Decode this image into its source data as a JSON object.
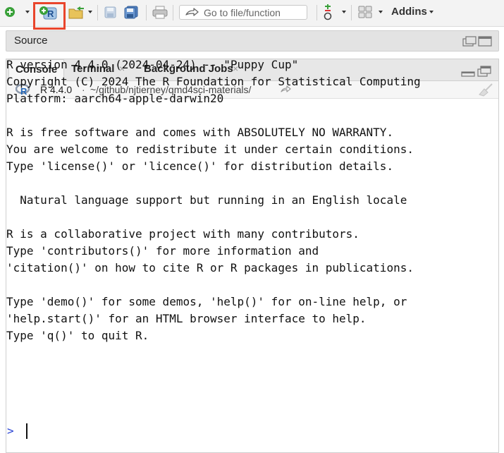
{
  "toolbar": {
    "goto_placeholder": "Go to file/function",
    "addins_label": "Addins"
  },
  "source_pane": {
    "title": "Source"
  },
  "console_pane": {
    "tabs": [
      {
        "label": "Console"
      },
      {
        "label": "Terminal",
        "close": "×"
      },
      {
        "label": "Background Jobs",
        "close": "×"
      }
    ],
    "r_version": "R 4.4.0",
    "dot": "·",
    "working_dir": "~/github/njtierney/qmd4sci-materials/",
    "output_lines": [
      "R version 4.4.0 (2024-04-24) -- \"Puppy Cup\"",
      "Copyright (C) 2024 The R Foundation for Statistical Computing",
      "Platform: aarch64-apple-darwin20",
      "",
      "R is free software and comes with ABSOLUTELY NO WARRANTY.",
      "You are welcome to redistribute it under certain conditions.",
      "Type 'license()' or 'licence()' for distribution details.",
      "",
      "  Natural language support but running in an English locale",
      "",
      "R is a collaborative project with many contributors.",
      "Type 'contributors()' for more information and",
      "'citation()' on how to cite R or R packages in publications.",
      "",
      "Type 'demo()' for some demos, 'help()' for on-line help, or",
      "'help.start()' for an HTML browser interface to help.",
      "Type 'q()' to quit R."
    ],
    "prompt": ">"
  },
  "colors": {
    "highlight": "#e9452c",
    "prompt": "#2b45d4",
    "add_green": "#3aa13a"
  }
}
